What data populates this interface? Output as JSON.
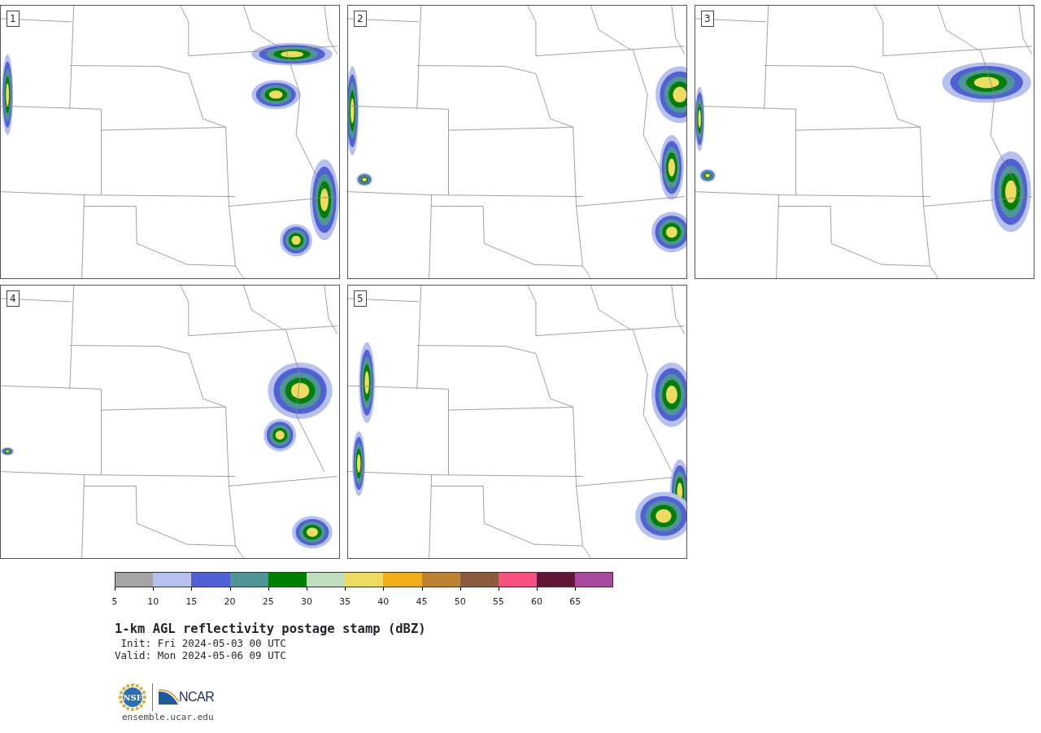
{
  "panels": [
    {
      "number": "1"
    },
    {
      "number": "2"
    },
    {
      "number": "3"
    },
    {
      "number": "4"
    },
    {
      "number": "5"
    }
  ],
  "colorbar": [
    {
      "label": "5",
      "color": "#a5a5a5"
    },
    {
      "label": "10",
      "color": "#b6c1ee"
    },
    {
      "label": "15",
      "color": "#5060d5"
    },
    {
      "label": "20",
      "color": "#4f9598"
    },
    {
      "label": "25",
      "color": "#008000"
    },
    {
      "label": "30",
      "color": "#bfdfbf"
    },
    {
      "label": "35",
      "color": "#f0db62"
    },
    {
      "label": "40",
      "color": "#f0ad16"
    },
    {
      "label": "45",
      "color": "#bc8230"
    },
    {
      "label": "50",
      "color": "#8a5b3d"
    },
    {
      "label": "55",
      "color": "#f55280"
    },
    {
      "label": "60",
      "color": "#621737"
    },
    {
      "label": "65",
      "color": "#a9499f"
    }
  ],
  "title": "1-km AGL reflectivity postage stamp (dBZ)",
  "init": " Init: Fri 2024-05-03 00 UTC",
  "valid": "Valid: Mon 2024-05-06 09 UTC",
  "logo": {
    "seal_text": "NSF",
    "wordmark": "NCAR"
  },
  "footer_link": "ensemble.ucar.edu"
}
